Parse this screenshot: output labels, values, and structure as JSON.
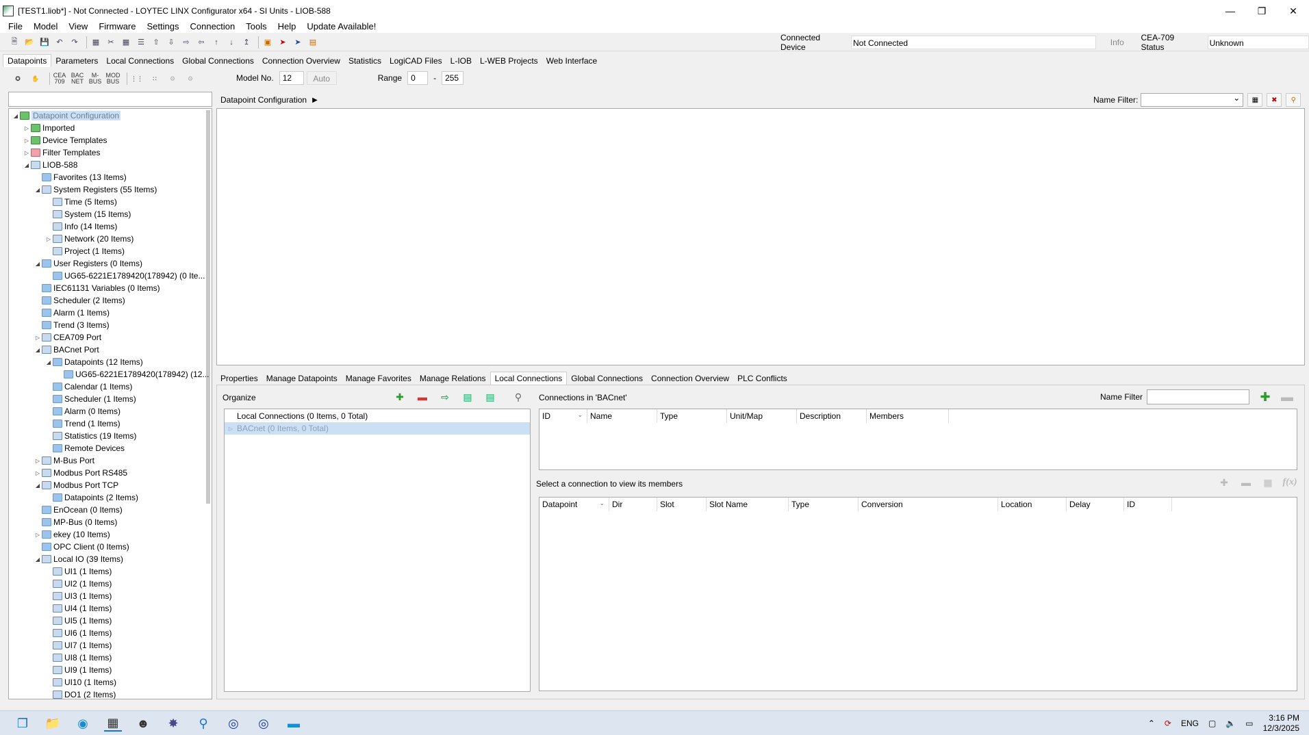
{
  "window": {
    "title": "[TEST1.liob*] - Not Connected - LOYTEC LINX Configurator x64 - SI Units - LIOB-588"
  },
  "menu": [
    "File",
    "Model",
    "View",
    "Firmware",
    "Settings",
    "Connection",
    "Tools",
    "Help",
    "Update Available!"
  ],
  "connection": {
    "connected_device_label": "Connected Device",
    "connected_device_value": "Not Connected",
    "info_button": "Info",
    "cea_status_label": "CEA-709 Status",
    "cea_status_value": "Unknown"
  },
  "main_tabs": [
    "Datapoints",
    "Parameters",
    "Local Connections",
    "Global Connections",
    "Connection Overview",
    "Statistics",
    "LogiCAD Files",
    "L-IOB",
    "L-WEB Projects",
    "Web Interface"
  ],
  "subtoolbar": {
    "icons": [
      "CEA 709",
      "BAC NET",
      "M- BUS",
      "MOD BUS"
    ],
    "model_label": "Model No.",
    "model_value": "12",
    "auto_button": "Auto",
    "range_label": "Range",
    "range_from": "0",
    "range_sep": "-",
    "range_to": "255"
  },
  "tree": [
    {
      "label": "Datapoint Configuration",
      "level": 0,
      "exp": "◢",
      "icon": "green",
      "selected": true
    },
    {
      "label": "Imported",
      "level": 1,
      "exp": "▷",
      "icon": "green"
    },
    {
      "label": "Device Templates",
      "level": 1,
      "exp": "▷",
      "icon": "green"
    },
    {
      "label": "Filter Templates",
      "level": 1,
      "exp": "▷",
      "icon": "red"
    },
    {
      "label": "LIOB-588",
      "level": 1,
      "exp": "◢",
      "icon": "locked"
    },
    {
      "label": "Favorites (13 Items)",
      "level": 2,
      "exp": "",
      "icon": "blue"
    },
    {
      "label": "System Registers (55 Items)",
      "level": 2,
      "exp": "◢",
      "icon": "locked"
    },
    {
      "label": "Time (5 Items)",
      "level": 3,
      "exp": "",
      "icon": "locked"
    },
    {
      "label": "System (15 Items)",
      "level": 3,
      "exp": "",
      "icon": "locked"
    },
    {
      "label": "Info (14 Items)",
      "level": 3,
      "exp": "",
      "icon": "locked"
    },
    {
      "label": "Network (20 Items)",
      "level": 3,
      "exp": "▷",
      "icon": "locked"
    },
    {
      "label": "Project (1 Items)",
      "level": 3,
      "exp": "",
      "icon": "locked"
    },
    {
      "label": "User Registers (0 Items)",
      "level": 2,
      "exp": "◢",
      "icon": "blue"
    },
    {
      "label": "UG65-6221E1789420(178942) (0 Ite...",
      "level": 3,
      "exp": "",
      "icon": "blue"
    },
    {
      "label": "IEC61131 Variables (0 Items)",
      "level": 2,
      "exp": "",
      "icon": "blue"
    },
    {
      "label": "Scheduler (2 Items)",
      "level": 2,
      "exp": "",
      "icon": "blue"
    },
    {
      "label": "Alarm (1 Items)",
      "level": 2,
      "exp": "",
      "icon": "blue"
    },
    {
      "label": "Trend (3 Items)",
      "level": 2,
      "exp": "",
      "icon": "blue"
    },
    {
      "label": "CEA709 Port",
      "level": 2,
      "exp": "▷",
      "icon": "locked"
    },
    {
      "label": "BACnet Port",
      "level": 2,
      "exp": "◢",
      "icon": "locked"
    },
    {
      "label": "Datapoints (12 Items)",
      "level": 3,
      "exp": "◢",
      "icon": "blue"
    },
    {
      "label": "UG65-6221E1789420(178942) (12...",
      "level": 4,
      "exp": "",
      "icon": "blue"
    },
    {
      "label": "Calendar (1 Items)",
      "level": 3,
      "exp": "",
      "icon": "blue"
    },
    {
      "label": "Scheduler (1 Items)",
      "level": 3,
      "exp": "",
      "icon": "blue"
    },
    {
      "label": "Alarm (0 Items)",
      "level": 3,
      "exp": "",
      "icon": "blue"
    },
    {
      "label": "Trend (1 Items)",
      "level": 3,
      "exp": "",
      "icon": "blue"
    },
    {
      "label": "Statistics (19 Items)",
      "level": 3,
      "exp": "",
      "icon": "locked"
    },
    {
      "label": "Remote Devices",
      "level": 3,
      "exp": "",
      "icon": "blue"
    },
    {
      "label": "M-Bus Port",
      "level": 2,
      "exp": "▷",
      "icon": "locked"
    },
    {
      "label": "Modbus Port RS485",
      "level": 2,
      "exp": "▷",
      "icon": "locked"
    },
    {
      "label": "Modbus Port TCP",
      "level": 2,
      "exp": "◢",
      "icon": "locked"
    },
    {
      "label": "Datapoints (2 Items)",
      "level": 3,
      "exp": "",
      "icon": "blue"
    },
    {
      "label": "EnOcean (0 Items)",
      "level": 2,
      "exp": "",
      "icon": "blue"
    },
    {
      "label": "MP-Bus (0 Items)",
      "level": 2,
      "exp": "",
      "icon": "blue"
    },
    {
      "label": "ekey (10 Items)",
      "level": 2,
      "exp": "▷",
      "icon": "blue"
    },
    {
      "label": "OPC Client (0 Items)",
      "level": 2,
      "exp": "",
      "icon": "blue"
    },
    {
      "label": "Local IO (39 Items)",
      "level": 2,
      "exp": "◢",
      "icon": "locked"
    },
    {
      "label": "UI1 (1 Items)",
      "level": 3,
      "exp": "",
      "icon": "locked"
    },
    {
      "label": "UI2 (1 Items)",
      "level": 3,
      "exp": "",
      "icon": "locked"
    },
    {
      "label": "UI3 (1 Items)",
      "level": 3,
      "exp": "",
      "icon": "locked"
    },
    {
      "label": "UI4 (1 Items)",
      "level": 3,
      "exp": "",
      "icon": "locked"
    },
    {
      "label": "UI5 (1 Items)",
      "level": 3,
      "exp": "",
      "icon": "locked"
    },
    {
      "label": "UI6 (1 Items)",
      "level": 3,
      "exp": "",
      "icon": "locked"
    },
    {
      "label": "UI7 (1 Items)",
      "level": 3,
      "exp": "",
      "icon": "locked"
    },
    {
      "label": "UI8 (1 Items)",
      "level": 3,
      "exp": "",
      "icon": "locked"
    },
    {
      "label": "UI9 (1 Items)",
      "level": 3,
      "exp": "",
      "icon": "locked"
    },
    {
      "label": "UI10 (1 Items)",
      "level": 3,
      "exp": "",
      "icon": "locked"
    },
    {
      "label": "DO1 (2 Items)",
      "level": 3,
      "exp": "",
      "icon": "locked"
    }
  ],
  "breadcrumb": "Datapoint Configuration",
  "name_filter_label": "Name Filter:",
  "sub_tabs": [
    "Properties",
    "Manage Datapoints",
    "Manage Favorites",
    "Manage Relations",
    "Local Connections",
    "Global Connections",
    "Connection Overview",
    "PLC Conflicts"
  ],
  "organize": {
    "label": "Organize",
    "rows": [
      {
        "label": "Local Connections (0 Items, 0 Total)",
        "exp": "",
        "selected": false
      },
      {
        "label": "BACnet (0 Items, 0 Total)",
        "exp": "▷",
        "selected": true
      }
    ]
  },
  "connections": {
    "title": "Connections in 'BACnet'",
    "name_filter_label": "Name Filter",
    "columns": [
      "ID",
      "Name",
      "Type",
      "Unit/Map",
      "Description",
      "Members"
    ]
  },
  "members": {
    "message": "Select a connection to view its members",
    "columns": [
      "Datapoint",
      "Dir",
      "Slot",
      "Slot Name",
      "Type",
      "Conversion",
      "Location",
      "Delay",
      "ID"
    ]
  },
  "tray": {
    "lang": "ENG",
    "time": "3:16 PM",
    "date": "12/3/2025"
  }
}
